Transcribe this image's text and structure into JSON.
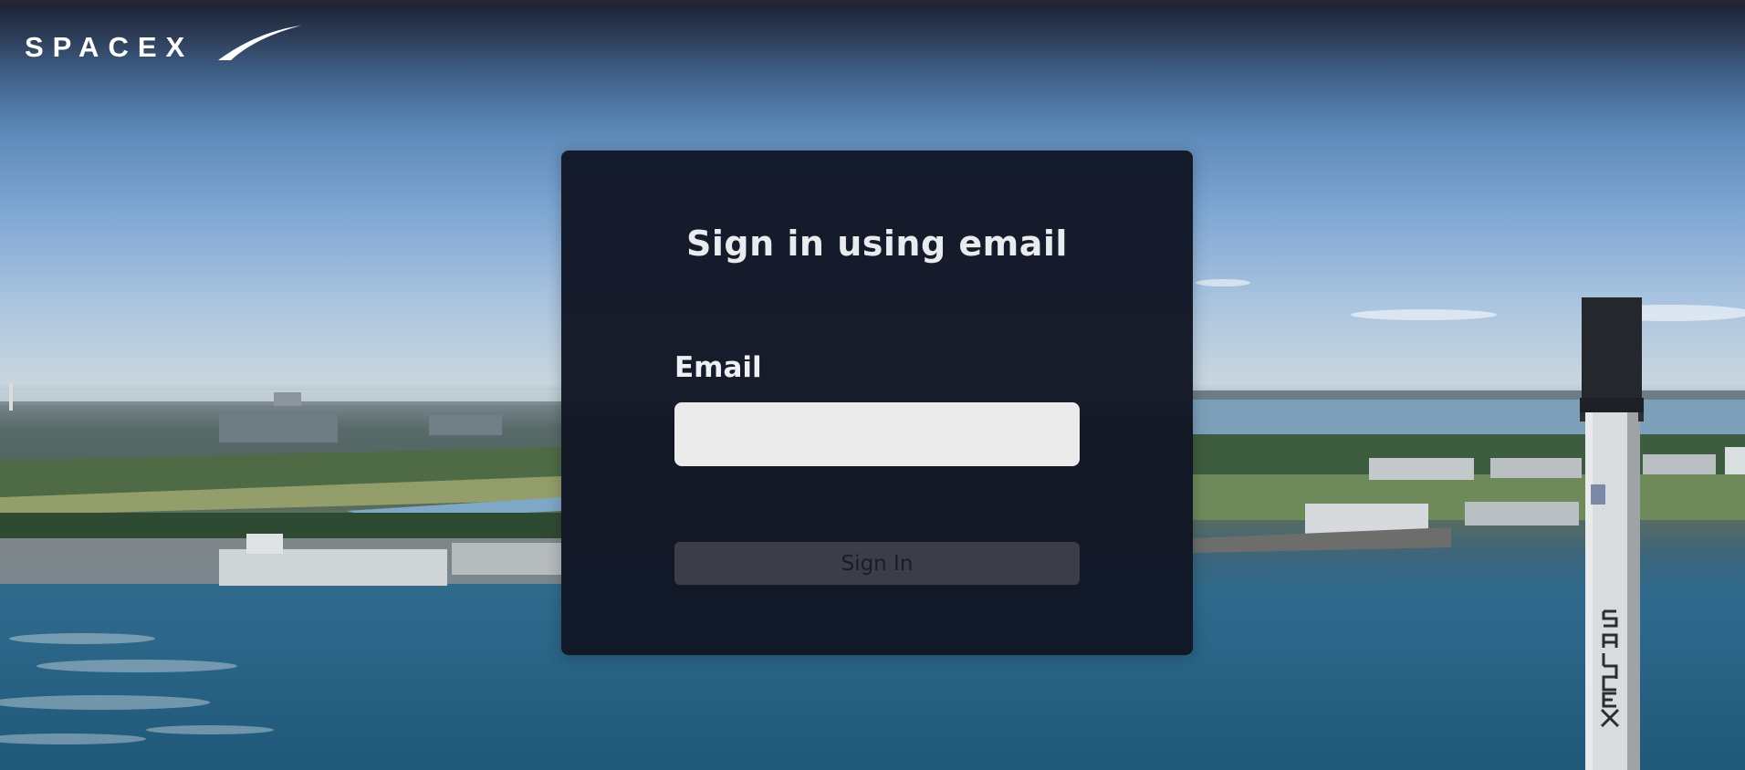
{
  "header": {
    "logo_text": "SPACEX"
  },
  "signin_card": {
    "title": "Sign in using email",
    "email_label": "Email",
    "email_value": "",
    "email_placeholder": "",
    "submit_label": "Sign In"
  },
  "colors": {
    "card_background": "#111624",
    "input_background": "#ebebeb",
    "button_background": "#3b3e48",
    "text_light": "#eef0f3"
  }
}
